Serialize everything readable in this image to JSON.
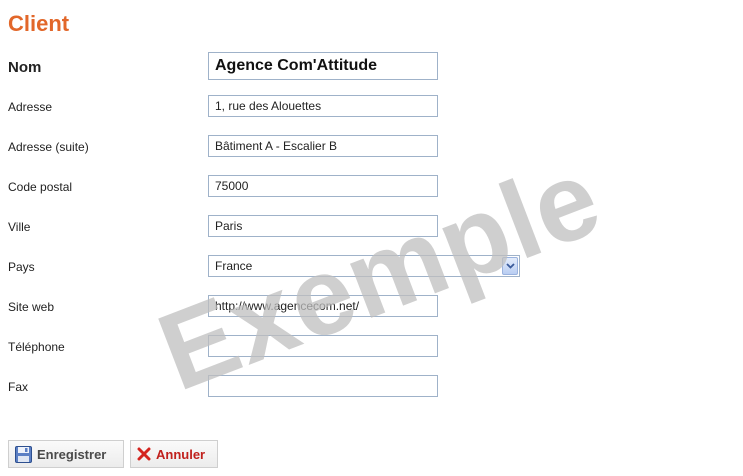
{
  "form": {
    "title": "Client",
    "fields": [
      {
        "label": "Nom",
        "value": "Agence Com'Attitude"
      },
      {
        "label": "Adresse",
        "value": "1, rue des Alouettes"
      },
      {
        "label": "Adresse (suite)",
        "value": "Bâtiment A - Escalier B"
      },
      {
        "label": "Code postal",
        "value": "75000"
      },
      {
        "label": "Ville",
        "value": "Paris"
      },
      {
        "label": "Pays",
        "value": "France"
      },
      {
        "label": "Site web",
        "value": "http://www.agencecom.net/"
      },
      {
        "label": "Téléphone",
        "value": ""
      },
      {
        "label": "Fax",
        "value": ""
      }
    ]
  },
  "watermark": "Exemple",
  "buttons": {
    "save_label": "Enregistrer",
    "cancel_label": "Annuler"
  },
  "colors": {
    "title": "#e2672a",
    "field_border": "#9fb2c9",
    "cancel_text": "#c0201c",
    "watermark": "#bfbfbf"
  }
}
